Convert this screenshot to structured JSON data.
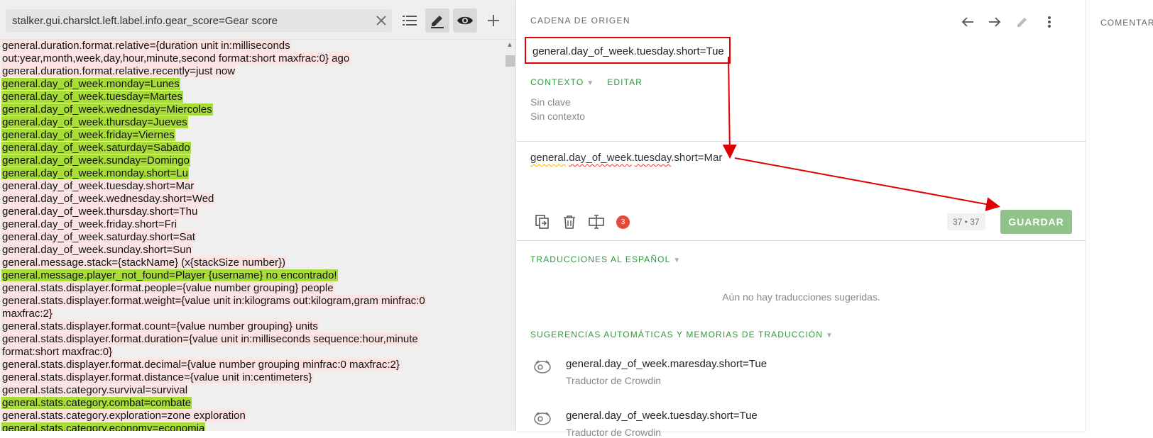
{
  "search": {
    "value": "stalker.gui.charslct.left.label.info.gear_score=Gear score"
  },
  "source_lines": [
    {
      "text": "general.duration.format.relative={duration unit in:milliseconds",
      "hl": "pink"
    },
    {
      "text": "out:year,month,week,day,hour,minute,second format:short maxfrac:0} ago",
      "hl": "pink"
    },
    {
      "text": "general.duration.format.relative.recently=just now",
      "hl": "pink"
    },
    {
      "text": "general.day_of_week.monday=Lunes",
      "hl": "green"
    },
    {
      "text": "general.day_of_week.tuesday=Martes",
      "hl": "green"
    },
    {
      "text": "general.day_of_week.wednesday=Miercoles",
      "hl": "green"
    },
    {
      "text": "general.day_of_week.thursday=Jueves",
      "hl": "green"
    },
    {
      "text": "general.day_of_week.friday=Viernes",
      "hl": "green"
    },
    {
      "text": "general.day_of_week.saturday=Sabado",
      "hl": "green"
    },
    {
      "text": "general.day_of_week.sunday=Domingo",
      "hl": "green"
    },
    {
      "text": "general.day_of_week.monday.short=Lu",
      "hl": "green"
    },
    {
      "text": "general.day_of_week.tuesday.short=Mar",
      "hl": "pink"
    },
    {
      "text": "general.day_of_week.wednesday.short=Wed",
      "hl": "pink"
    },
    {
      "text": "general.day_of_week.thursday.short=Thu",
      "hl": "pink"
    },
    {
      "text": "general.day_of_week.friday.short=Fri",
      "hl": "pink"
    },
    {
      "text": "general.day_of_week.saturday.short=Sat",
      "hl": "pink"
    },
    {
      "text": "general.day_of_week.sunday.short=Sun",
      "hl": "pink"
    },
    {
      "text": "general.message.stack={stackName} (x{stackSize number})",
      "hl": "pink"
    },
    {
      "text": "general.message.player_not_found=Player {username} no encontrado!",
      "hl": "green"
    },
    {
      "text": "general.stats.displayer.format.people={value number grouping} people",
      "hl": "pink"
    },
    {
      "text": "general.stats.displayer.format.weight={value unit in:kilograms out:kilogram,gram minfrac:0",
      "hl": "pink"
    },
    {
      "text": "maxfrac:2}",
      "hl": "pink"
    },
    {
      "text": "general.stats.displayer.format.count={value number grouping} units",
      "hl": "pink"
    },
    {
      "text": "general.stats.displayer.format.duration={value unit in:milliseconds sequence:hour,minute",
      "hl": "pink"
    },
    {
      "text": "format:short maxfrac:0}",
      "hl": "pink"
    },
    {
      "text": "general.stats.displayer.format.decimal={value number grouping minfrac:0 maxfrac:2}",
      "hl": "pink"
    },
    {
      "text": "general.stats.displayer.format.distance={value unit in:centimeters}",
      "hl": "pink"
    },
    {
      "text": "general.stats.category.survival=survival",
      "hl": "pink"
    },
    {
      "text": "general.stats.category.combat=combate",
      "hl": "green"
    },
    {
      "text": "general.stats.category.exploration=zone exploration",
      "hl": "pink"
    },
    {
      "text": "general.stats.category.economy=economia",
      "hl": "green"
    }
  ],
  "middle": {
    "header": "CADENA DE ORIGEN",
    "source_string": "general.day_of_week.tuesday.short=Tue",
    "context_label": "CONTEXTO",
    "edit_label": "EDITAR",
    "no_key": "Sin clave",
    "no_context": "Sin contexto",
    "translation": {
      "p1": "general",
      "d1": ".",
      "p2": "day_of_week",
      "d2": ".",
      "p3": "tuesday",
      "rest": ".short=Mar"
    },
    "issues_count": "3",
    "char_count": "37 • 37",
    "save_label": "GUARDAR",
    "translations_header": "TRADUCCIONES AL ESPAÑOL",
    "no_suggestions": "Aún no hay traducciones sugeridas.",
    "tm_header": "SUGERENCIAS AUTOMÁTICAS Y MEMORIAS DE TRADUCCIÓN",
    "tm_items": [
      {
        "text": "general.day_of_week.maresday.short=Tue",
        "source": "Traductor de Crowdin"
      },
      {
        "text": "general.day_of_week.tuesday.short=Tue",
        "source": "Traductor de Crowdin"
      }
    ]
  },
  "right": {
    "header": "COMENTARIOS"
  },
  "colors": {
    "accent_green": "#2e9a3a",
    "save_button": "#8fc38a",
    "highlight_green": "#a8dc36",
    "highlight_pink": "#fbe3e3",
    "annotation_red": "#e00000",
    "badge_red": "#e24b3b"
  }
}
